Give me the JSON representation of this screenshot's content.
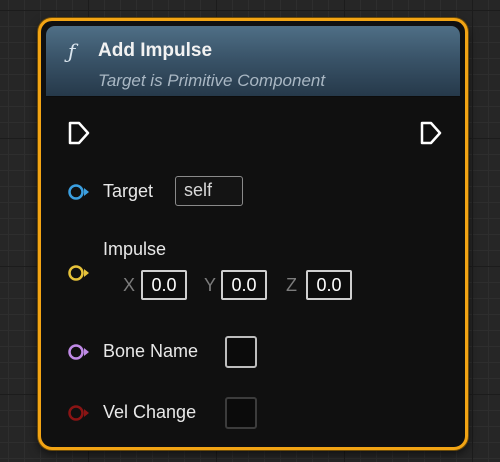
{
  "node": {
    "function_icon": "ƒ",
    "title": "Add Impulse",
    "subtitle": "Target is Primitive Component",
    "exec_in_icon": "exec-pin-in",
    "exec_out_icon": "exec-pin-out",
    "border_color": "#f2a414",
    "pins": {
      "target": {
        "label": "Target",
        "value": "self",
        "color": "#3b9fe0"
      },
      "impulse": {
        "label": "Impulse",
        "color": "#e6c23a",
        "x_label": "X",
        "x_value": "0.0",
        "y_label": "Y",
        "y_value": "0.0",
        "z_label": "Z",
        "z_value": "0.0"
      },
      "bone_name": {
        "label": "Bone Name",
        "checked": false,
        "color": "#c08ae6"
      },
      "vel_change": {
        "label": "Vel Change",
        "checked": false,
        "color": "#8a1414"
      }
    }
  }
}
